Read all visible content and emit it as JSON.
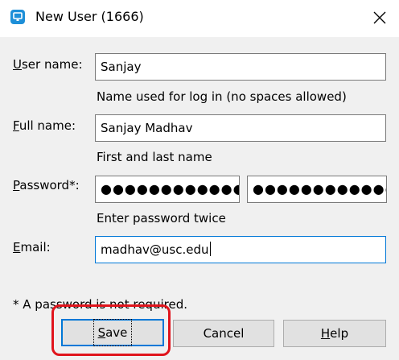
{
  "window": {
    "title": "New User (1666)"
  },
  "form": {
    "username": {
      "label": "User name:",
      "mnemonic": "U",
      "rest": "ser name:",
      "value": "Sanjay",
      "hint": "Name used for log in (no spaces allowed)"
    },
    "fullname": {
      "label": "Full name:",
      "mnemonic": "F",
      "rest": "ull name:",
      "value": "Sanjay Madhav",
      "hint": "First and last name"
    },
    "password": {
      "label": "Password*:",
      "mnemonic": "P",
      "rest": "assword*:",
      "value": "●●●●●●●●●●●●",
      "confirm_value": "●●●●●●●●●●●●",
      "hint": "Enter password twice"
    },
    "email": {
      "label": "Email:",
      "mnemonic": "E",
      "rest": "mail:",
      "value": "madhav@usc.edu"
    },
    "footnote": "* A password is not required."
  },
  "buttons": {
    "save": {
      "label": "Save",
      "mnemonic": "S",
      "rest": "ave"
    },
    "cancel": {
      "label": "Cancel"
    },
    "help": {
      "label": "Help",
      "mnemonic": "H",
      "rest": "elp"
    }
  },
  "icons": {
    "app": "app-monitor-icon",
    "close": "close-icon"
  },
  "colors": {
    "accent": "#0078d7",
    "highlight": "#e0141c",
    "app_icon": "#1d8fd8"
  }
}
